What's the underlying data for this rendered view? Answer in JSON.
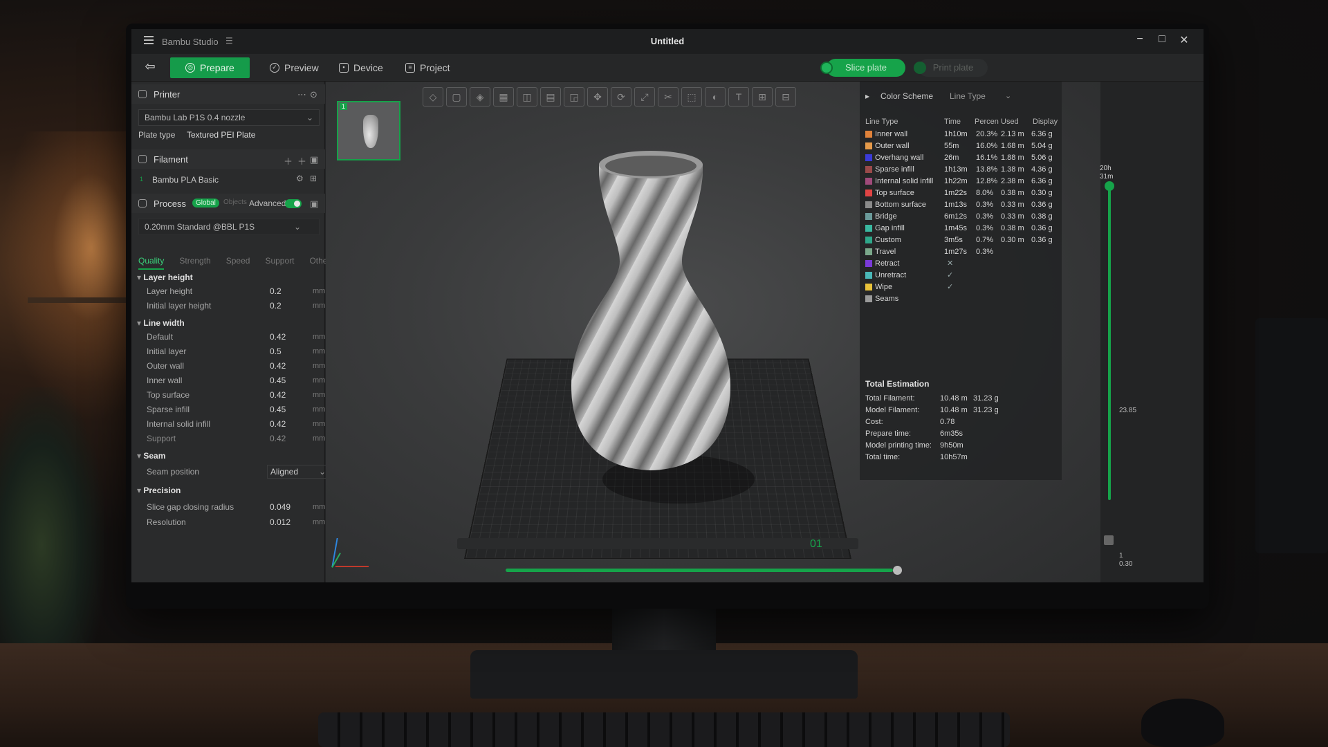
{
  "window": {
    "app_name": "Bambu Studio",
    "title": "Untitled",
    "minimize": "−",
    "maximize": "□",
    "close": "✕"
  },
  "toolbar": {
    "back_icon": "back-arrow-icon",
    "tabs": [
      {
        "label": "Prepare",
        "active": true
      },
      {
        "label": "Preview",
        "active": false
      },
      {
        "label": "Device",
        "active": false
      },
      {
        "label": "Project",
        "active": false
      }
    ],
    "slice_label": "Slice plate",
    "print_label": "Print plate",
    "accent_color": "#16a34a"
  },
  "left_panel": {
    "printer": {
      "title": "Printer",
      "selected": "Bambu Lab P1S 0.4 nozzle",
      "plate_type_label": "Plate type",
      "plate_type_value": "Textured PEI Plate"
    },
    "filament": {
      "title": "Filament",
      "slot": "1",
      "name": "Bambu PLA Basic"
    },
    "process": {
      "title": "Process",
      "global_label": "Global",
      "objects_label": "Objects",
      "advanced_label": "Advanced",
      "advanced_on": true,
      "preset": "0.20mm Standard @BBL P1S",
      "subtabs": [
        "Quality",
        "Strength",
        "Speed",
        "Support",
        "Others"
      ],
      "active_subtab": "Quality"
    },
    "groups": {
      "layer_height": {
        "title": "Layer height",
        "rows": [
          {
            "label": "Layer height",
            "value": "0.2",
            "unit": "mm"
          },
          {
            "label": "Initial layer height",
            "value": "0.2",
            "unit": "mm"
          }
        ]
      },
      "line_width": {
        "title": "Line width",
        "rows": [
          {
            "label": "Default",
            "value": "0.42",
            "unit": "mm"
          },
          {
            "label": "Initial layer",
            "value": "0.5",
            "unit": "mm"
          },
          {
            "label": "Outer wall",
            "value": "0.42",
            "unit": "mm"
          },
          {
            "label": "Inner wall",
            "value": "0.45",
            "unit": "mm"
          },
          {
            "label": "Top surface",
            "value": "0.42",
            "unit": "mm"
          },
          {
            "label": "Sparse infill",
            "value": "0.45",
            "unit": "mm"
          },
          {
            "label": "Internal solid infill",
            "value": "0.42",
            "unit": "mm"
          },
          {
            "label": "Support",
            "value": "0.42",
            "unit": "mm"
          }
        ]
      },
      "seam": {
        "title": "Seam",
        "position_label": "Seam position",
        "position_value": "Aligned"
      },
      "precision": {
        "title": "Precision",
        "rows": [
          {
            "label": "Slice gap closing radius",
            "value": "0.049",
            "unit": "mm"
          },
          {
            "label": "Resolution",
            "value": "0.012",
            "unit": "mm"
          }
        ]
      }
    }
  },
  "viewport": {
    "plate_number": "1",
    "plate_label": "01"
  },
  "legend": {
    "scheme_label": "Color Scheme",
    "scheme_value": "Line Type",
    "columns": {
      "type": "Line Type",
      "time": "Time",
      "percent": "Percen",
      "used": "Used",
      "display": "Display"
    },
    "rows": [
      {
        "name": "Inner wall",
        "color": "#e0823a",
        "time": "1h10m",
        "percent": "20.3%",
        "used": "2.13 m",
        "grams": "6.36 g"
      },
      {
        "name": "Outer wall",
        "color": "#e59a4a",
        "time": "55m",
        "percent": "16.0%",
        "used": "1.68 m",
        "grams": "5.04 g"
      },
      {
        "name": "Overhang wall",
        "color": "#3b3bd8",
        "time": "26m",
        "percent": "16.1%",
        "used": "1.88 m",
        "grams": "5.06 g"
      },
      {
        "name": "Sparse infill",
        "color": "#9a4a4a",
        "time": "1h13m",
        "percent": "13.8%",
        "used": "1.38 m",
        "grams": "4.36 g"
      },
      {
        "name": "Internal solid infill",
        "color": "#a04a7a",
        "time": "1h22m",
        "percent": "12.8%",
        "used": "2.38 m",
        "grams": "6.36 g"
      },
      {
        "name": "Top surface",
        "color": "#e04444",
        "time": "1m22s",
        "percent": "8.0%",
        "used": "0.38 m",
        "grams": "0.30 g"
      },
      {
        "name": "Bottom surface",
        "color": "#8a8a8a",
        "time": "1m13s",
        "percent": "0.3%",
        "used": "0.33 m",
        "grams": "0.36 g"
      },
      {
        "name": "Bridge",
        "color": "#6a9a9a",
        "time": "6m12s",
        "percent": "0.3%",
        "used": "0.33 m",
        "grams": "0.38 g"
      },
      {
        "name": "Gap infill",
        "color": "#3ab8a0",
        "time": "1m45s",
        "percent": "0.3%",
        "used": "0.38 m",
        "grams": "0.36 g"
      },
      {
        "name": "Custom",
        "color": "#2ea88a",
        "time": "3m5s",
        "percent": "0.7%",
        "used": "0.30 m",
        "grams": "0.36 g"
      },
      {
        "name": "Travel",
        "color": "#7aa88a",
        "time": "1m27s",
        "percent": "0.3%",
        "used": "",
        "grams": ""
      },
      {
        "name": "Retract",
        "color": "#7a3ad8",
        "check": "✕"
      },
      {
        "name": "Unretract",
        "color": "#4ab8b8",
        "check": "✓"
      },
      {
        "name": "Wipe",
        "color": "#e8c23a",
        "check": "✓"
      },
      {
        "name": "Seams",
        "color": "#9a9a9a",
        "check": ""
      }
    ],
    "estimation": {
      "title": "Total Estimation",
      "rows": [
        {
          "k": "Total Filament:",
          "v1": "10.48 m",
          "v2": "31.23 g"
        },
        {
          "k": "Model Filament:",
          "v1": "10.48 m",
          "v2": "31.23 g"
        },
        {
          "k": "Cost:",
          "v1": "0.78",
          "v2": ""
        },
        {
          "k": "Prepare time:",
          "v1": "6m35s",
          "v2": ""
        },
        {
          "k": "Model printing time:",
          "v1": "9h50m",
          "v2": ""
        },
        {
          "k": "Total time:",
          "v1": "10h57m",
          "v2": ""
        }
      ]
    }
  },
  "layer_slider": {
    "top_value": "20h",
    "top_sub": "31m",
    "mid_value": "23.85",
    "bottom_layer": "1",
    "bottom_height": "0.30"
  }
}
